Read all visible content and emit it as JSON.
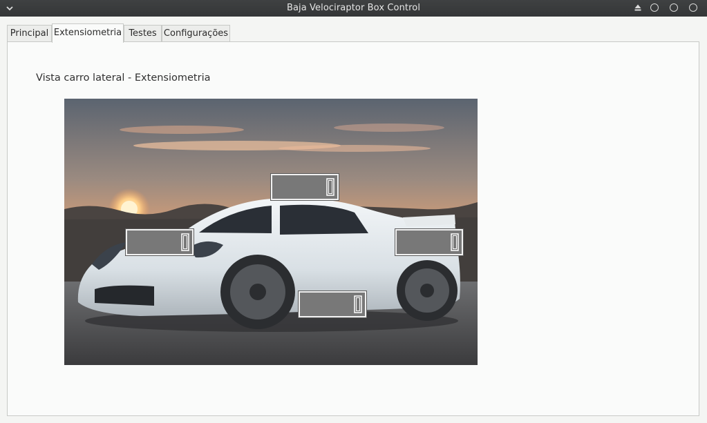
{
  "window": {
    "title": "Baja Velociraptor Box Control",
    "controls": [
      "eject-icon",
      "minimize-icon",
      "maximize-icon",
      "close-icon"
    ]
  },
  "tabs": [
    {
      "label": "Principal",
      "active": false
    },
    {
      "label": "Extensiometria",
      "active": true
    },
    {
      "label": "Testes",
      "active": false
    },
    {
      "label": "Configurações",
      "active": false
    }
  ],
  "main": {
    "heading": "Vista carro lateral - Extensiometria",
    "image_subject": "white sports car, side view at sunset",
    "displays": [
      {
        "id": "top",
        "value": "0"
      },
      {
        "id": "front",
        "value": "0"
      },
      {
        "id": "rear",
        "value": "0"
      },
      {
        "id": "bottom",
        "value": "0"
      }
    ]
  },
  "colors": {
    "titlebar": "#3a3c3d",
    "display_bg": "#787878",
    "segment": "#ffffff"
  }
}
